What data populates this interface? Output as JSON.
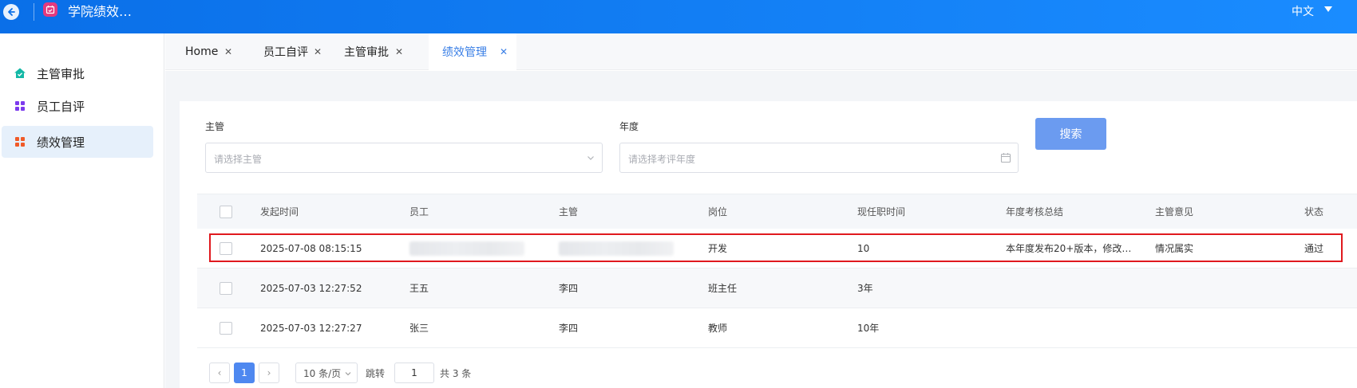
{
  "header": {
    "app_title": "学院绩效…",
    "language": "中文",
    "back_icon": "arrow-left-icon",
    "logo_icon": "calendar-check-icon",
    "gradient_start": "#0a6fe8",
    "gradient_end": "#1a8cff"
  },
  "sidebar": {
    "items": [
      {
        "label": "主管审批",
        "icon": "house-check-icon",
        "color": "#14b8a6"
      },
      {
        "label": "员工自评",
        "icon": "grid-icon",
        "color": "#7c3aed"
      },
      {
        "label": "绩效管理",
        "icon": "grid-icon",
        "color": "#f05a28",
        "active": true
      }
    ]
  },
  "tabs": [
    {
      "label": "Home",
      "close": "✕"
    },
    {
      "label": "员工自评",
      "close": "✕"
    },
    {
      "label": "主管审批",
      "close": "✕"
    },
    {
      "label": "绩效管理",
      "close": "✕",
      "active": true
    }
  ],
  "filters": {
    "manager_label": "主管",
    "manager_placeholder": "请选择主管",
    "year_label": "年度",
    "year_placeholder": "请选择考评年度",
    "search_label": "搜索"
  },
  "table": {
    "columns": [
      "发起时间",
      "员工",
      "主管",
      "岗位",
      "现任职时间",
      "年度考核总结",
      "主管意见",
      "状态"
    ],
    "rows": [
      {
        "time": "2025-07-08 08:15:15",
        "employee": "",
        "manager": "",
        "position": "开发",
        "tenure": "10",
        "summary": "本年度发布20+版本，修改…",
        "opinion": "情况属实",
        "status": "通过"
      },
      {
        "time": "2025-07-03 12:27:52",
        "employee": "王五",
        "manager": "李四",
        "position": "班主任",
        "tenure": "3年",
        "summary": "",
        "opinion": "",
        "status": ""
      },
      {
        "time": "2025-07-03 12:27:27",
        "employee": "张三",
        "manager": "李四",
        "position": "教师",
        "tenure": "10年",
        "summary": "",
        "opinion": "",
        "status": ""
      }
    ],
    "highlight_color": "#e0191e"
  },
  "pagination": {
    "prev": "‹",
    "current_page": "1",
    "next": "›",
    "page_size": "10 条/页",
    "jump_label": "跳转",
    "jump_value": "1",
    "total": "共 3 条"
  }
}
